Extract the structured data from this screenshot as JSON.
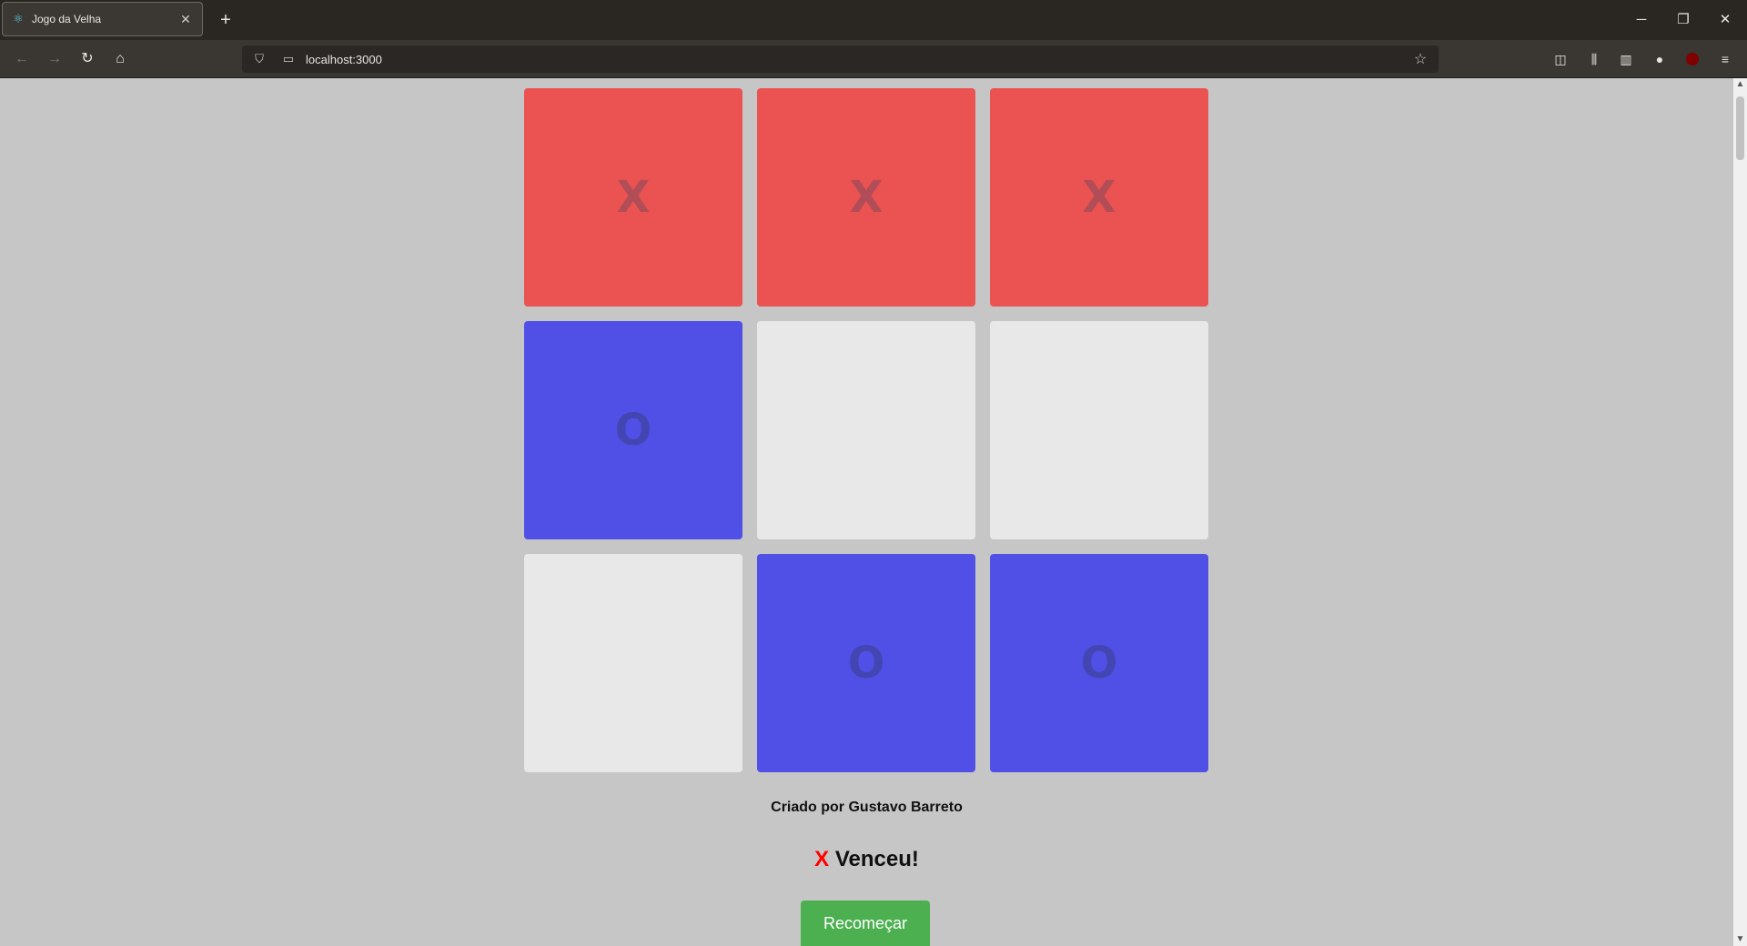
{
  "browser": {
    "tab_title": "Jogo da Velha",
    "tab_favicon": "react-icon",
    "url": "localhost:3000"
  },
  "game": {
    "board": [
      [
        "X",
        "X",
        "X"
      ],
      [
        "O",
        "",
        ""
      ],
      [
        "",
        "O",
        "O"
      ]
    ],
    "colors": {
      "x": "#eb5252",
      "o": "#5150e6",
      "empty": "#e8e8e8"
    },
    "credit": "Criado por Gustavo Barreto",
    "winner": "X",
    "result_text": "Venceu!",
    "restart_label": "Recomeçar"
  }
}
